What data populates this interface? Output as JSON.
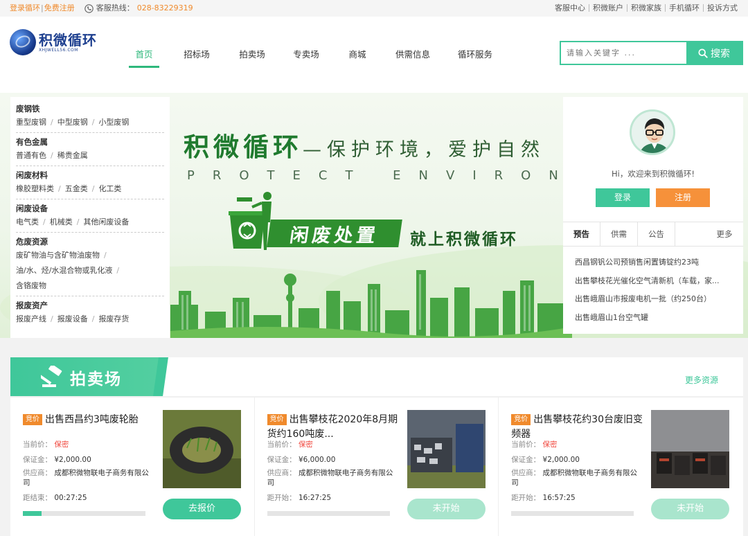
{
  "topbar": {
    "login": "登录循环",
    "register": "免费注册",
    "hotline_label": "客服热线：",
    "hotline_number": "028-83229319",
    "links": [
      "客服中心",
      "积微账户",
      "积微家族",
      "手机循环",
      "投诉方式"
    ]
  },
  "logo": {
    "cn": "积微循环",
    "en": "XHJWELL56.COM"
  },
  "nav": [
    "首页",
    "招标场",
    "拍卖场",
    "专卖场",
    "商城",
    "供需信息",
    "循环服务"
  ],
  "search": {
    "placeholder": "请输入关键字 ...",
    "button": "搜索"
  },
  "categories": [
    {
      "title": "废钢铁",
      "links": [
        "重型废钢",
        "中型废钢",
        "小型废钢"
      ]
    },
    {
      "title": "有色金属",
      "links": [
        "普通有色",
        "稀贵金属"
      ]
    },
    {
      "title": "闲废材料",
      "links": [
        "橡胶塑料类",
        "五金类",
        "化工类"
      ]
    },
    {
      "title": "闲废设备",
      "links": [
        "电气类",
        "机械类",
        "其他闲废设备"
      ]
    },
    {
      "title": "危废资源",
      "links": [
        "废矿物油与含矿物油废物",
        "油/水、烃/水混合物或乳化液",
        "含铬废物"
      ]
    },
    {
      "title": "报废资产",
      "links": [
        "报废产线",
        "报废设备",
        "报废存货"
      ]
    }
  ],
  "banner": {
    "main": "积微循环",
    "sub": "—保护环境，爱护自然",
    "english": "PROTECT ENVIRONMENT",
    "sign": "闲废处置",
    "sign_right": "就上积微循环"
  },
  "user_panel": {
    "welcome": "Hi，欢迎来到积微循环!",
    "login": "登录",
    "register": "注册",
    "tabs": [
      "预告",
      "供需",
      "公告"
    ],
    "more": "更多",
    "news": [
      "西昌钢钒公司预销售闲置铸锭约23吨",
      "出售攀枝花光催化空气清新机（车载，家...",
      "出售峨眉山市报废电机一批（约250台）",
      "出售峨眉山1台空气罐"
    ]
  },
  "auction": {
    "title": "拍卖场",
    "more": "更多资源",
    "cards": [
      {
        "tag": "竞价",
        "title": "出售西昌约3吨废轮胎",
        "price_label": "当前价：",
        "price": "保密",
        "deposit_label": "保证金：",
        "deposit": "¥2,000.00",
        "supplier_label": "供应商：",
        "supplier": "成都积微物联电子商务有限公司",
        "time_label": "距结束：",
        "time": "00:27:25",
        "progress": 0.15,
        "button": "去报价",
        "button_active": true
      },
      {
        "tag": "竞价",
        "title": "出售攀枝花2020年8月期货约160吨废...",
        "price_label": "当前价：",
        "price": "保密",
        "deposit_label": "保证金：",
        "deposit": "¥6,000.00",
        "supplier_label": "供应商：",
        "supplier": "成都积微物联电子商务有限公司",
        "time_label": "距开始：",
        "time": "16:27:25",
        "progress": 0,
        "button": "未开始",
        "button_active": false
      },
      {
        "tag": "竞价",
        "title": "出售攀枝花约30台废旧变频器",
        "price_label": "当前价：",
        "price": "保密",
        "deposit_label": "保证金：",
        "deposit": "¥2,000.00",
        "supplier_label": "供应商：",
        "supplier": "成都积微物联电子商务有限公司",
        "time_label": "距开始：",
        "time": "16:57:25",
        "progress": 0,
        "button": "未开始",
        "button_active": false
      }
    ]
  },
  "colors": {
    "accent": "#3fc79a",
    "orange": "#f08a2c",
    "red": "#f0463c",
    "logo_blue": "#1d3f8f"
  }
}
